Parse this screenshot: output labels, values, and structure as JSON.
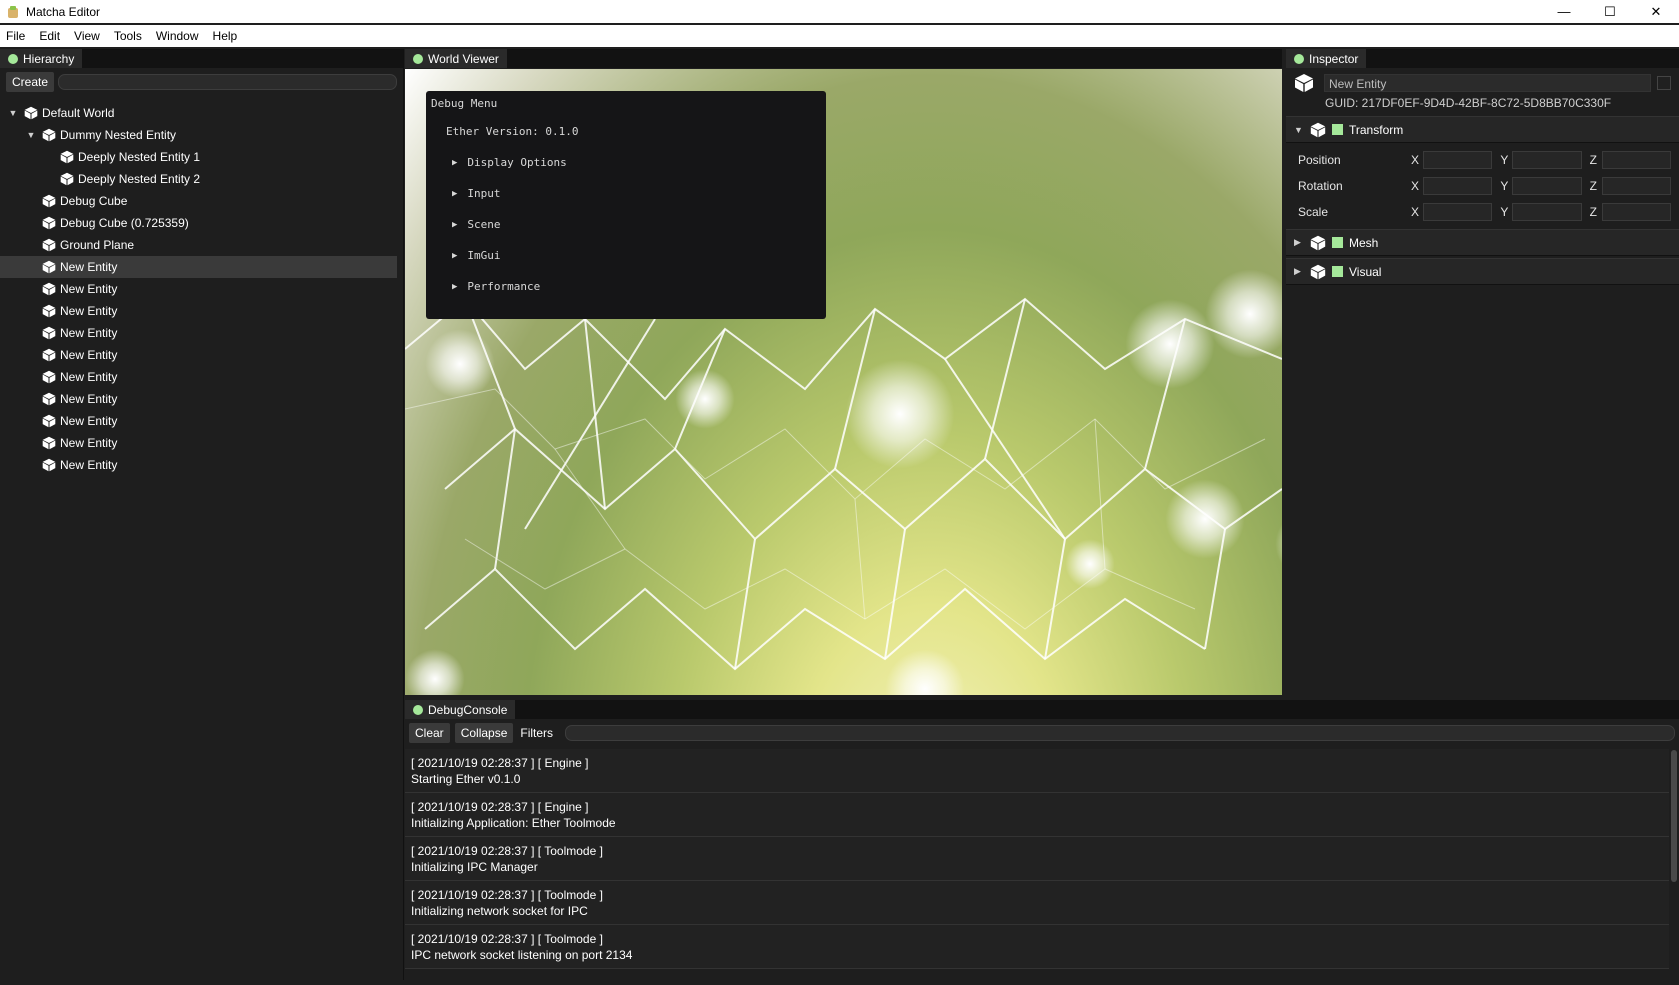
{
  "window": {
    "title": "Matcha Editor",
    "controls": [
      "—",
      "☐",
      "✕"
    ]
  },
  "menu": [
    "File",
    "Edit",
    "View",
    "Tools",
    "Window",
    "Help"
  ],
  "hierarchy": {
    "tab_label": "Hierarchy",
    "create_label": "Create",
    "items": [
      {
        "label": "Default World",
        "indent": 0,
        "expanded": true,
        "selected": false
      },
      {
        "label": "Dummy Nested Entity",
        "indent": 1,
        "expanded": true,
        "selected": false
      },
      {
        "label": "Deeply Nested Entity 1",
        "indent": 2,
        "expanded": null,
        "selected": false
      },
      {
        "label": "Deeply Nested Entity 2",
        "indent": 2,
        "expanded": null,
        "selected": false
      },
      {
        "label": "Debug Cube",
        "indent": 1,
        "expanded": null,
        "selected": false
      },
      {
        "label": "Debug Cube (0.725359)",
        "indent": 1,
        "expanded": null,
        "selected": false
      },
      {
        "label": "Ground Plane",
        "indent": 1,
        "expanded": null,
        "selected": false
      },
      {
        "label": "New Entity",
        "indent": 1,
        "expanded": null,
        "selected": true
      },
      {
        "label": "New Entity",
        "indent": 1,
        "expanded": null,
        "selected": false
      },
      {
        "label": "New Entity",
        "indent": 1,
        "expanded": null,
        "selected": false
      },
      {
        "label": "New Entity",
        "indent": 1,
        "expanded": null,
        "selected": false
      },
      {
        "label": "New Entity",
        "indent": 1,
        "expanded": null,
        "selected": false
      },
      {
        "label": "New Entity",
        "indent": 1,
        "expanded": null,
        "selected": false
      },
      {
        "label": "New Entity",
        "indent": 1,
        "expanded": null,
        "selected": false
      },
      {
        "label": "New Entity",
        "indent": 1,
        "expanded": null,
        "selected": false
      },
      {
        "label": "New Entity",
        "indent": 1,
        "expanded": null,
        "selected": false
      },
      {
        "label": "New Entity",
        "indent": 1,
        "expanded": null,
        "selected": false
      }
    ]
  },
  "viewer": {
    "tab_label": "World Viewer",
    "debug_menu": {
      "title": "Debug Menu",
      "version": "Ether Version: 0.1.0",
      "items": [
        "Display Options",
        "Input",
        "Scene",
        "ImGui",
        "Performance"
      ]
    }
  },
  "inspector": {
    "tab_label": "Inspector",
    "entity_name": "New Entity",
    "guid": "GUID: 217DF0EF-9D4D-42BF-8C72-5D8BB70C330F",
    "components": [
      {
        "label": "Transform",
        "expanded": true
      },
      {
        "label": "Mesh",
        "expanded": false
      },
      {
        "label": "Visual",
        "expanded": false
      }
    ],
    "transform_rows": [
      "Position",
      "Rotation",
      "Scale"
    ],
    "axes": [
      "X",
      "Y",
      "Z"
    ]
  },
  "console": {
    "tab_label": "DebugConsole",
    "clear_label": "Clear",
    "collapse_label": "Collapse",
    "filters_label": "Filters",
    "entries": [
      {
        "meta": "[ 2021/10/19 02:28:37 ] [ Engine ]",
        "msg": "Starting Ether v0.1.0"
      },
      {
        "meta": "[ 2021/10/19 02:28:37 ] [ Engine ]",
        "msg": "Initializing Application: Ether Toolmode"
      },
      {
        "meta": "[ 2021/10/19 02:28:37 ] [ Toolmode ]",
        "msg": "Initializing IPC Manager"
      },
      {
        "meta": "[ 2021/10/19 02:28:37 ] [ Toolmode ]",
        "msg": "Initializing network socket for IPC"
      },
      {
        "meta": "[ 2021/10/19 02:28:37 ] [ Toolmode ]",
        "msg": "IPC network socket listening on port 2134"
      }
    ]
  },
  "colors": {
    "accent_green": "#a5e89a",
    "panel_bg": "#1e1e1e",
    "tab_bg": "#2a2a2a"
  }
}
